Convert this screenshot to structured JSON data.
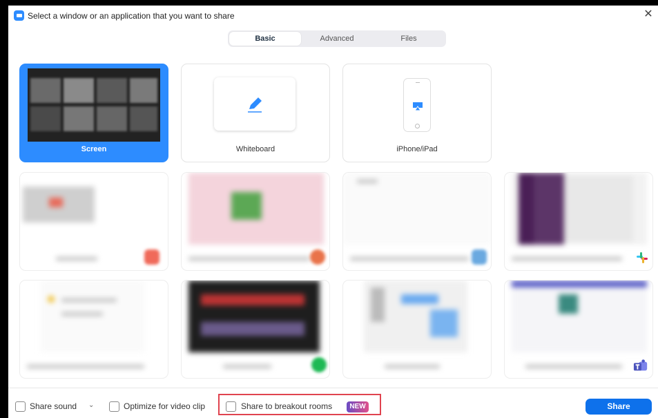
{
  "window": {
    "title": "Select a window or an application that you want to share",
    "close": "✕"
  },
  "tabs": [
    {
      "label": "Basic",
      "active": true
    },
    {
      "label": "Advanced",
      "active": false
    },
    {
      "label": "Files",
      "active": false
    }
  ],
  "tiles": {
    "screen": "Screen",
    "whiteboard": "Whiteboard",
    "iphone": "iPhone/iPad"
  },
  "footer": {
    "share_sound": "Share sound",
    "dropdown": "⌄",
    "optimize": "Optimize for video clip",
    "breakout": "Share to breakout rooms",
    "new_badge": "NEW",
    "share_button": "Share"
  },
  "colors": {
    "accent": "#2d8cff",
    "share_button": "#0e71eb",
    "highlight": "#e0434f"
  },
  "icons": [
    "zoom-logo-icon",
    "close-icon",
    "pencil-icon",
    "airplay-icon",
    "slack-icon",
    "teams-icon",
    "chevron-down-icon"
  ]
}
